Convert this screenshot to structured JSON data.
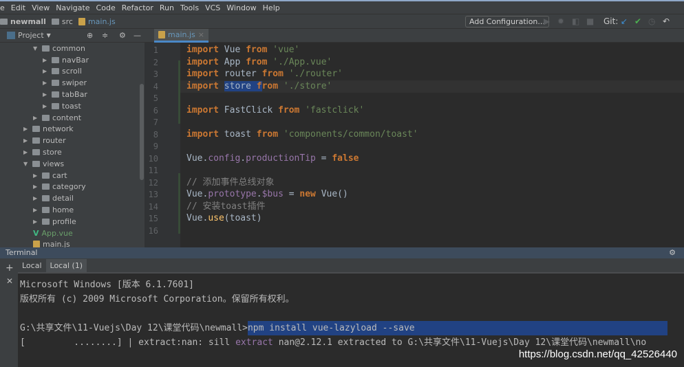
{
  "menu": [
    "e",
    "Edit",
    "View",
    "Navigate",
    "Code",
    "Refactor",
    "Run",
    "Tools",
    "VCS",
    "Window",
    "Help"
  ],
  "breadcrumb": {
    "project": "newmall",
    "folder": "src",
    "file": "main.js"
  },
  "toolbar": {
    "add_configuration": "Add Configuration...",
    "git_label": "Git:"
  },
  "project_panel": {
    "title": "Project",
    "tree": [
      {
        "label": "common",
        "depth": 3,
        "type": "folder",
        "expanded": true
      },
      {
        "label": "navBar",
        "depth": 4,
        "type": "folder"
      },
      {
        "label": "scroll",
        "depth": 4,
        "type": "folder"
      },
      {
        "label": "swiper",
        "depth": 4,
        "type": "folder"
      },
      {
        "label": "tabBar",
        "depth": 4,
        "type": "folder"
      },
      {
        "label": "toast",
        "depth": 4,
        "type": "folder"
      },
      {
        "label": "content",
        "depth": 3,
        "type": "folder"
      },
      {
        "label": "network",
        "depth": 2,
        "type": "folder"
      },
      {
        "label": "router",
        "depth": 2,
        "type": "folder"
      },
      {
        "label": "store",
        "depth": 2,
        "type": "folder"
      },
      {
        "label": "views",
        "depth": 2,
        "type": "folder",
        "expanded": true
      },
      {
        "label": "cart",
        "depth": 3,
        "type": "folder"
      },
      {
        "label": "category",
        "depth": 3,
        "type": "folder"
      },
      {
        "label": "detail",
        "depth": 3,
        "type": "folder"
      },
      {
        "label": "home",
        "depth": 3,
        "type": "folder"
      },
      {
        "label": "profile",
        "depth": 3,
        "type": "folder"
      },
      {
        "label": "App.vue",
        "depth": 2,
        "type": "vue"
      },
      {
        "label": "main.js",
        "depth": 2,
        "type": "js"
      }
    ]
  },
  "editor": {
    "tab": "main.js",
    "lines": [
      "<span class='kw'>import</span> Vue <span class='kw'>from</span> <span class='str'>'vue'</span>",
      "<span class='kw'>import</span> App <span class='kw'>from</span> <span class='str'>'./App.vue'</span>",
      "<span class='kw'>import</span> router <span class='kw'>from</span> <span class='str'>'./router'</span>",
      "<span class='kw'>import</span> <span class='sel'>store <span class='kw'>f</span></span><span class='kw'>rom</span> <span class='str'>'./store'</span>",
      "",
      "<span class='kw'>import</span> FastClick <span class='kw'>from</span> <span class='str'>'fastclick'</span>",
      "",
      "<span class='kw'>import</span> toast <span class='kw'>from</span> <span class='str'>'components/common/toast'</span>",
      "",
      "Vue.<span class='prop'>config</span>.<span class='prop'>productionTip</span> = <span class='kw'>false</span>",
      "",
      "<span class='cm'>// 添加事件总线对象</span>",
      "Vue.<span class='prop'>prototype</span>.<span class='prop'>$bus</span> = <span class='kw'>new</span> Vue()",
      "<span class='cm'>// 安装toast插件</span>",
      "Vue.<span class='fn'>use</span>(toast)",
      ""
    ]
  },
  "terminal": {
    "title": "Terminal",
    "tabs": [
      "Local",
      "Local (1)"
    ],
    "active_tab": 1,
    "lines": [
      "Microsoft Windows [版本 6.1.7601]",
      "版权所有 (c) 2009 Microsoft Corporation。保留所有权利。",
      "",
      "G:\\共享文件\\11-Vuejs\\Day 12\\课堂代码\\newmall>",
      "[         ........] | extract:nan: sill "
    ],
    "command": "npm install vue-lazyload --save",
    "extract_word": "extract",
    "extract_rest": " nan@2.12.1 extracted to G:\\共享文件\\11-Vuejs\\Day 12\\课堂代码\\newmall\\no"
  },
  "watermark": "https://blog.csdn.net/qq_42526440"
}
